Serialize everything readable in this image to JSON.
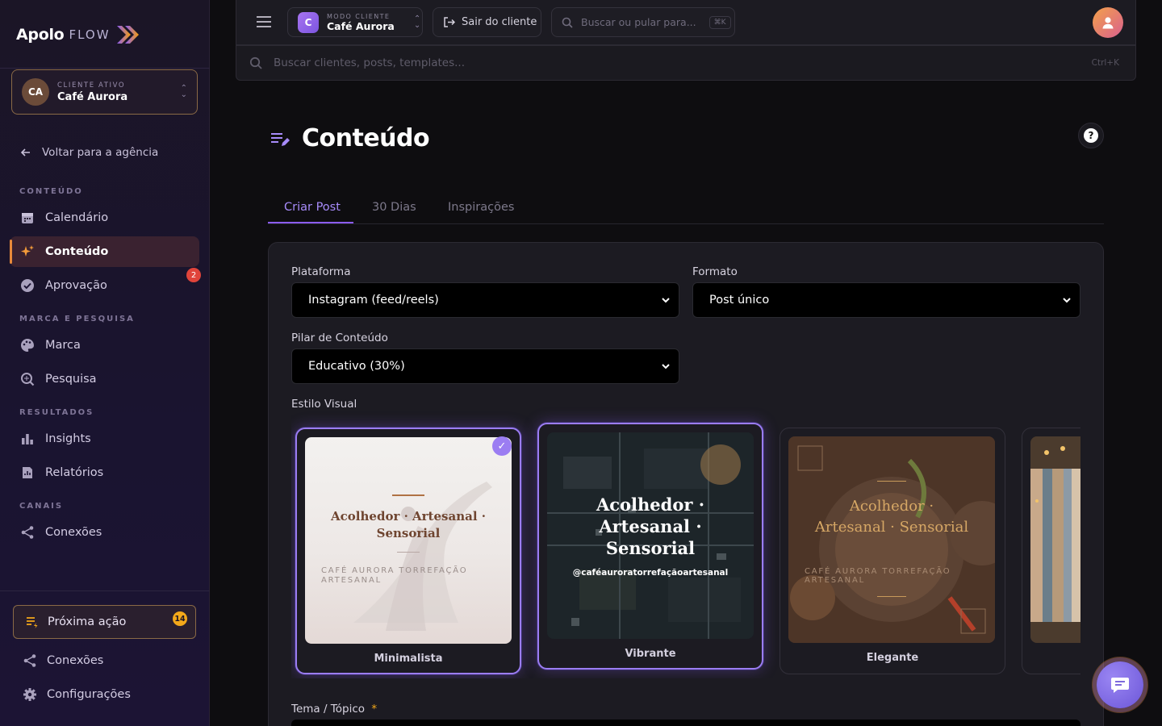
{
  "brand": {
    "name": "Apolo",
    "suffix": "FLOW",
    "accent": "#8b5cf6",
    "accent_orange": "#f3a81a"
  },
  "sidebar": {
    "client": {
      "kicker": "CLIENTE ATIVO",
      "name": "Café Aurora",
      "initials": "CA"
    },
    "back_label": "Voltar para a agência",
    "sections": {
      "content": "CONTEÚDO",
      "brand_research": "MARCA E PESQUISA",
      "results": "RESULTADOS",
      "channels": "CANAIS"
    },
    "items": {
      "calendar": "Calendário",
      "content": "Conteúdo",
      "approval": "Aprovação",
      "approval_badge": "2",
      "brand": "Marca",
      "research": "Pesquisa",
      "insights": "Insights",
      "reports": "Relatórios",
      "connections": "Conexões"
    },
    "next_action": {
      "label": "Próxima ação",
      "badge": "14"
    },
    "bottom": {
      "connections": "Conexões",
      "settings": "Configurações"
    }
  },
  "topbar": {
    "mode": {
      "kicker": "MODO CLIENTE",
      "name": "Café Aurora",
      "letter": "C"
    },
    "exit_label": "Sair do cliente",
    "search_placeholder": "Buscar ou pular para...",
    "search_shortcut": "⌘K"
  },
  "global_search": {
    "placeholder": "Buscar clientes, posts, templates...",
    "shortcut": "Ctrl+K"
  },
  "page": {
    "title": "Conteúdo",
    "tabs": [
      "Criar Post",
      "30 Dias",
      "Inspirações"
    ],
    "form": {
      "platform_label": "Plataforma",
      "platform_value": "Instagram (feed/reels)",
      "format_label": "Formato",
      "format_value": "Post único",
      "pillar_label": "Pilar de Conteúdo",
      "pillar_value": "Educativo (30%)",
      "style_label": "Estilo Visual",
      "topic_label": "Tema / Tópico",
      "topic_required": "*"
    },
    "styles": [
      {
        "name": "Minimalista",
        "quote": "Acolhedor · Artesanal · Sensorial",
        "brand_line": "CAFÉ AURORA TORREFAÇÃO ARTESANAL",
        "selected": true
      },
      {
        "name": "Vibrante",
        "quote": "Acolhedor · Artesanal · Sensorial",
        "handle": "@caféauroratorrefaçãoartesanal",
        "selected": false
      },
      {
        "name": "Elegante",
        "quote": "Acolhedor · Artesanal · Sensorial",
        "brand_line": "CAFÉ AURORA TORREFAÇÃO ARTESANAL",
        "selected": false
      }
    ]
  }
}
